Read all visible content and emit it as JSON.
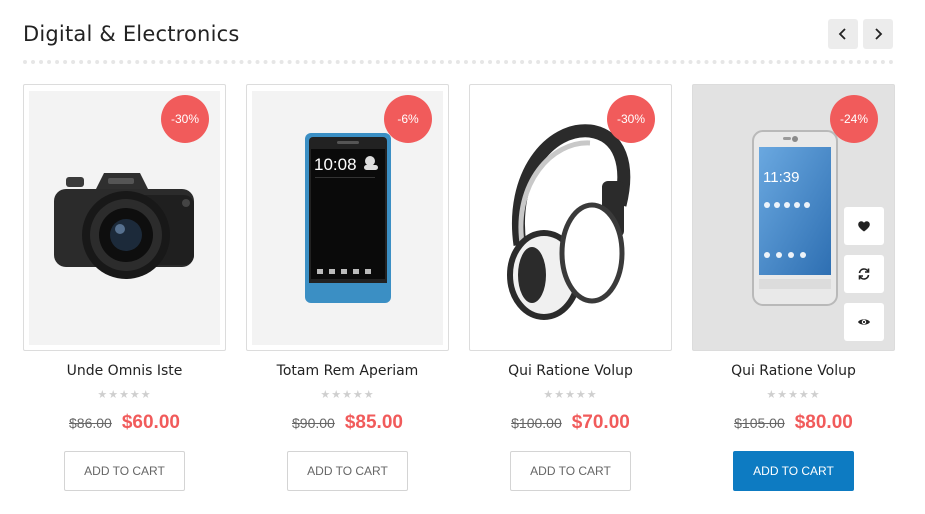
{
  "section": {
    "title": "Digital & Electronics"
  },
  "products": [
    {
      "name": "Unde Omnis Iste",
      "discount": "-30%",
      "old_price": "$86.00",
      "new_price": "$60.00",
      "rating": 0,
      "stars": "★★★★★",
      "button_label": "ADD TO CART",
      "image": "camera"
    },
    {
      "name": "Totam Rem Aperiam",
      "discount": "-6%",
      "old_price": "$90.00",
      "new_price": "$85.00",
      "rating": 0,
      "stars": "★★★★★",
      "button_label": "ADD TO CART",
      "image": "smartphone-htc",
      "screen": {
        "time": "10:08"
      }
    },
    {
      "name": "Qui Ratione Volup",
      "discount": "-30%",
      "old_price": "$100.00",
      "new_price": "$70.00",
      "rating": 0,
      "stars": "★★★★★",
      "button_label": "ADD TO CART",
      "image": "headphones"
    },
    {
      "name": "Qui Ratione Volup",
      "discount": "-24%",
      "old_price": "$105.00",
      "new_price": "$80.00",
      "rating": 0,
      "stars": "★★★★★",
      "button_label": "ADD TO CART",
      "image": "smartphone-asus",
      "screen": {
        "time": "11:39"
      },
      "actions": [
        "heart-icon",
        "compare-icon",
        "eye-icon"
      ]
    }
  ],
  "colors": {
    "accent_red": "#f15b5b",
    "primary_blue": "#0d7bc2"
  }
}
